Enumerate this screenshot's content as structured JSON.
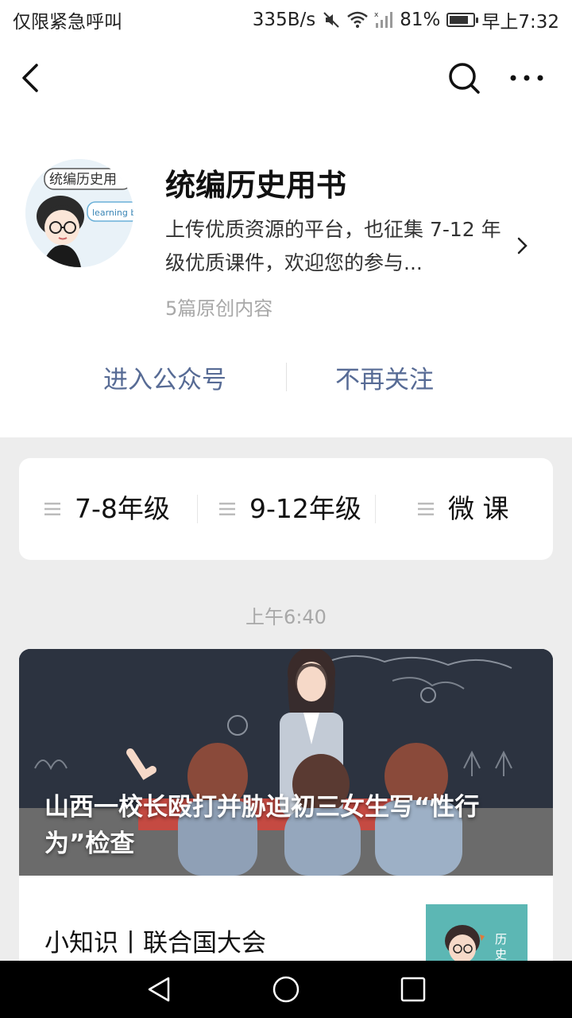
{
  "status_bar": {
    "carrier": "仅限紧急呼叫",
    "speed": "335B/s",
    "battery": "81%",
    "battery_level": 0.81,
    "time": "早上7:32"
  },
  "top_bar": {
    "back_icon": "back-chevron-icon",
    "search_icon": "search-icon",
    "more_icon": "more-dots-icon"
  },
  "profile": {
    "name": "统编历史用书",
    "description": "上传优质资源的平台，也征集 7-12 年级优质课件，欢迎您的参与...",
    "count": "5篇原创内容",
    "avatar_text_1": "统编历史用",
    "avatar_text_2": "learning boo",
    "enter_label": "进入公众号",
    "unfollow_label": "不再关注"
  },
  "menu": {
    "items": [
      {
        "label": "7-8年级"
      },
      {
        "label": "9-12年级"
      },
      {
        "label": "微 课"
      }
    ]
  },
  "timestamp": "上午6:40",
  "article": {
    "cover_title": "山西一校长殴打并胁迫初三女生写“性行为”检查",
    "sub_title": "小知识丨联合国大会",
    "thumb_text": "历史小"
  },
  "colors": {
    "link": "#576b95",
    "background": "#ededed",
    "cover_bg": "#2c3340"
  }
}
